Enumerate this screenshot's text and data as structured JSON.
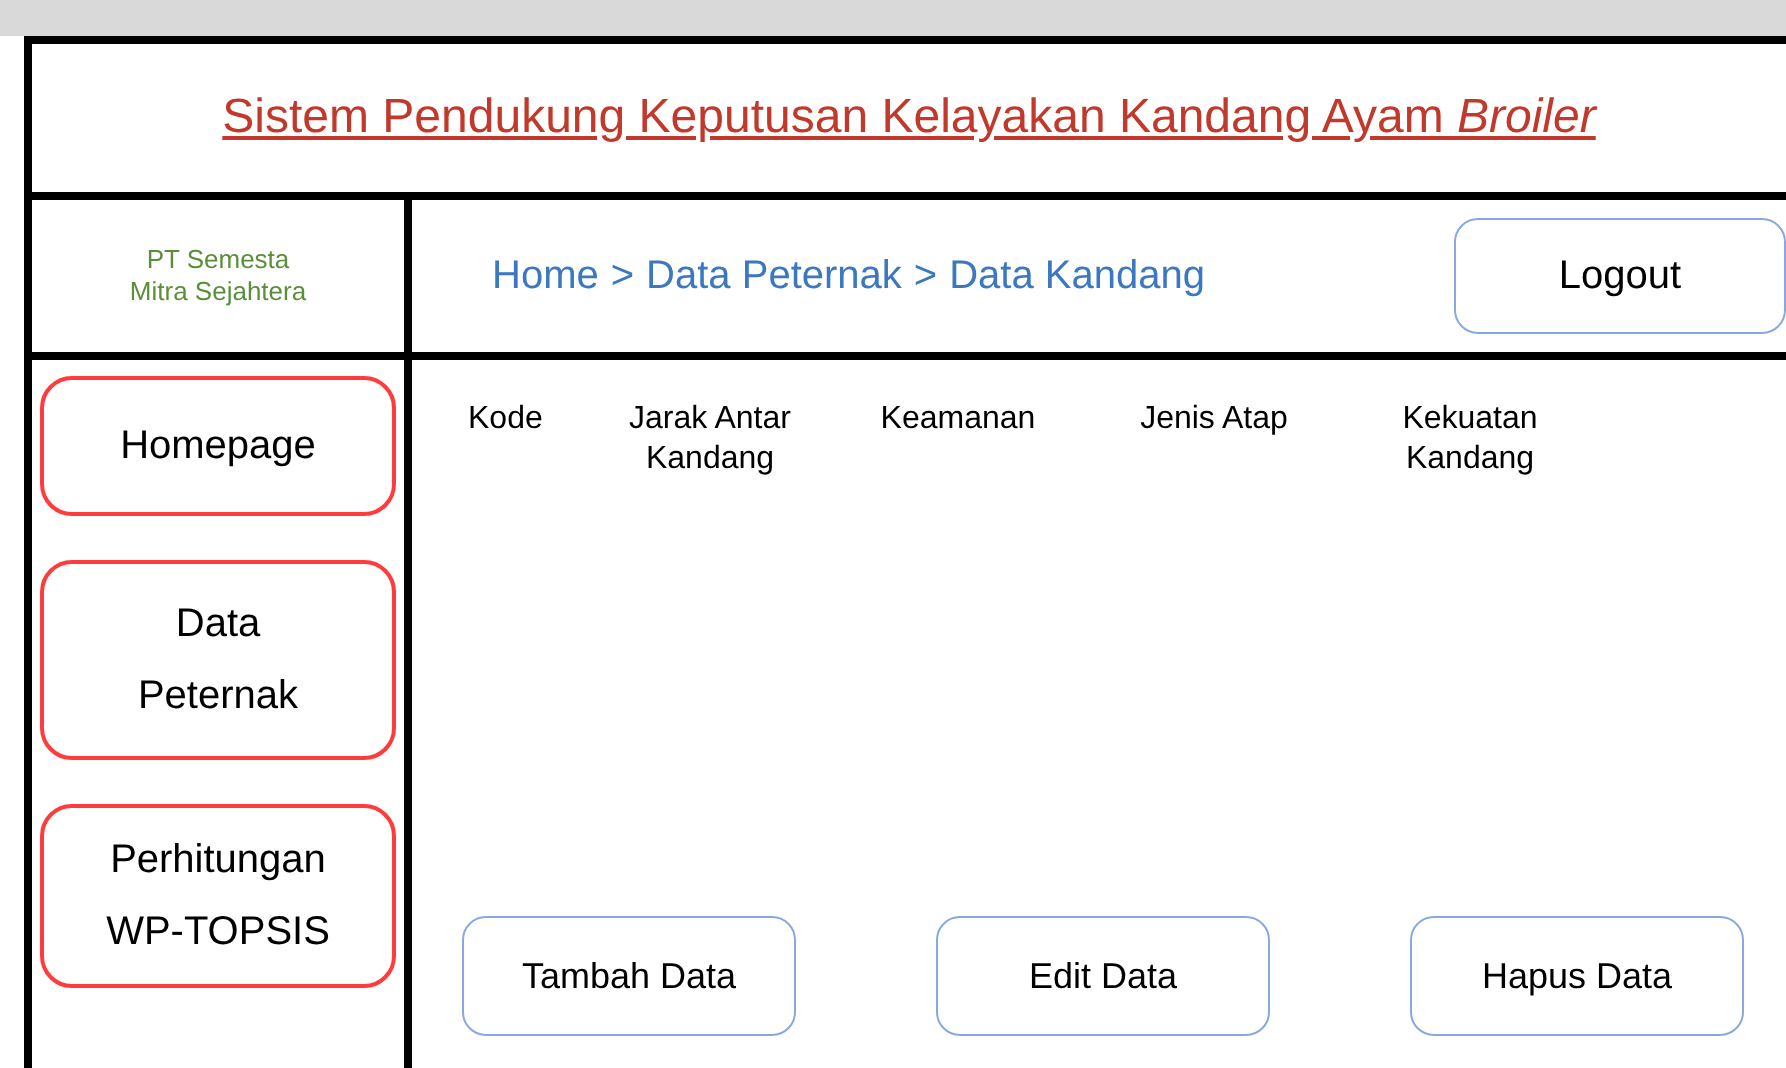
{
  "title": "Sistem Pendukung Keputusan Kelayakan Kandang Ayam *Broiler*",
  "company": [
    "PT Semesta",
    "Mitra Sejahtera"
  ],
  "breadcrumb": [
    "Home",
    ">",
    "Data Peternak",
    ">",
    "Data Kandang"
  ],
  "logout": "Logout",
  "sidebar": {
    "items": [
      {
        "label": "Homepage"
      },
      {
        "label": "Data Peternak"
      },
      {
        "label": "Perhitungan WP-TOPSIS"
      }
    ]
  },
  "table": {
    "columns": [
      "Kode",
      "Jarak Antar Kandang",
      "Keamanan",
      "Jenis Atap",
      "Kekuatan Kandang"
    ]
  },
  "buttons": [
    "Tambah Data",
    "Edit Data",
    "Hapus Data"
  ]
}
